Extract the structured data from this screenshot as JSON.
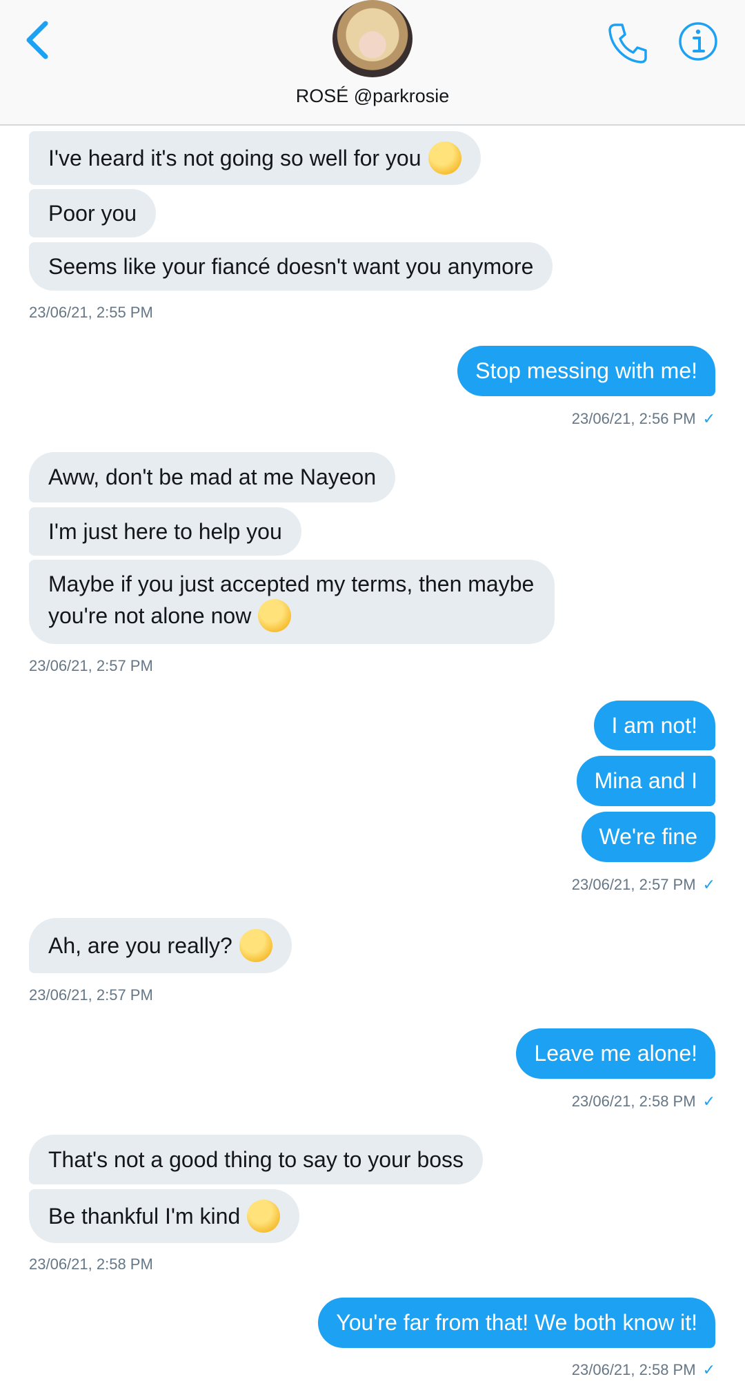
{
  "header": {
    "name": "ROSÉ @parkrosie",
    "back_icon": "chevron-left-icon",
    "call_icon": "phone-icon",
    "info_icon": "info-icon"
  },
  "colors": {
    "accent": "#1da1f2",
    "incoming_bubble": "#e6ecf0",
    "timestamp": "#657786"
  },
  "messages": [
    {
      "text": "I've heard it's not going so well for you",
      "emoji": "frowning-face-emoji"
    },
    {
      "text": "Poor you"
    },
    {
      "text": "Seems like your fiancé doesn't want you anymore"
    },
    {
      "timestamp": "23/06/21, 2:55 PM"
    },
    {
      "text": "Stop messing with me!"
    },
    {
      "timestamp": "23/06/21, 2:56 PM"
    },
    {
      "text": "Aww, don't be mad at me Nayeon"
    },
    {
      "text": "I'm just here to help you"
    },
    {
      "text": "Maybe if you just accepted my terms, then maybe you're not alone now",
      "emoji": "grinning-squinting-face-emoji"
    },
    {
      "timestamp": "23/06/21, 2:57 PM"
    },
    {
      "text": "I am not!"
    },
    {
      "text": "Mina and I"
    },
    {
      "text": "We're fine"
    },
    {
      "timestamp": "23/06/21, 2:57 PM"
    },
    {
      "text": "Ah, are you really?",
      "emoji": "thinking-face-emoji"
    },
    {
      "timestamp": "23/06/21, 2:57 PM"
    },
    {
      "text": "Leave me alone!"
    },
    {
      "timestamp": "23/06/21, 2:58 PM"
    },
    {
      "text": "That's not a good thing to say to your boss"
    },
    {
      "text": "Be thankful I'm kind",
      "emoji": "relieved-face-emoji"
    },
    {
      "timestamp": "23/06/21, 2:58 PM"
    },
    {
      "text": "You're far from that! We both know it!"
    },
    {
      "timestamp": "23/06/21, 2:58 PM"
    }
  ]
}
